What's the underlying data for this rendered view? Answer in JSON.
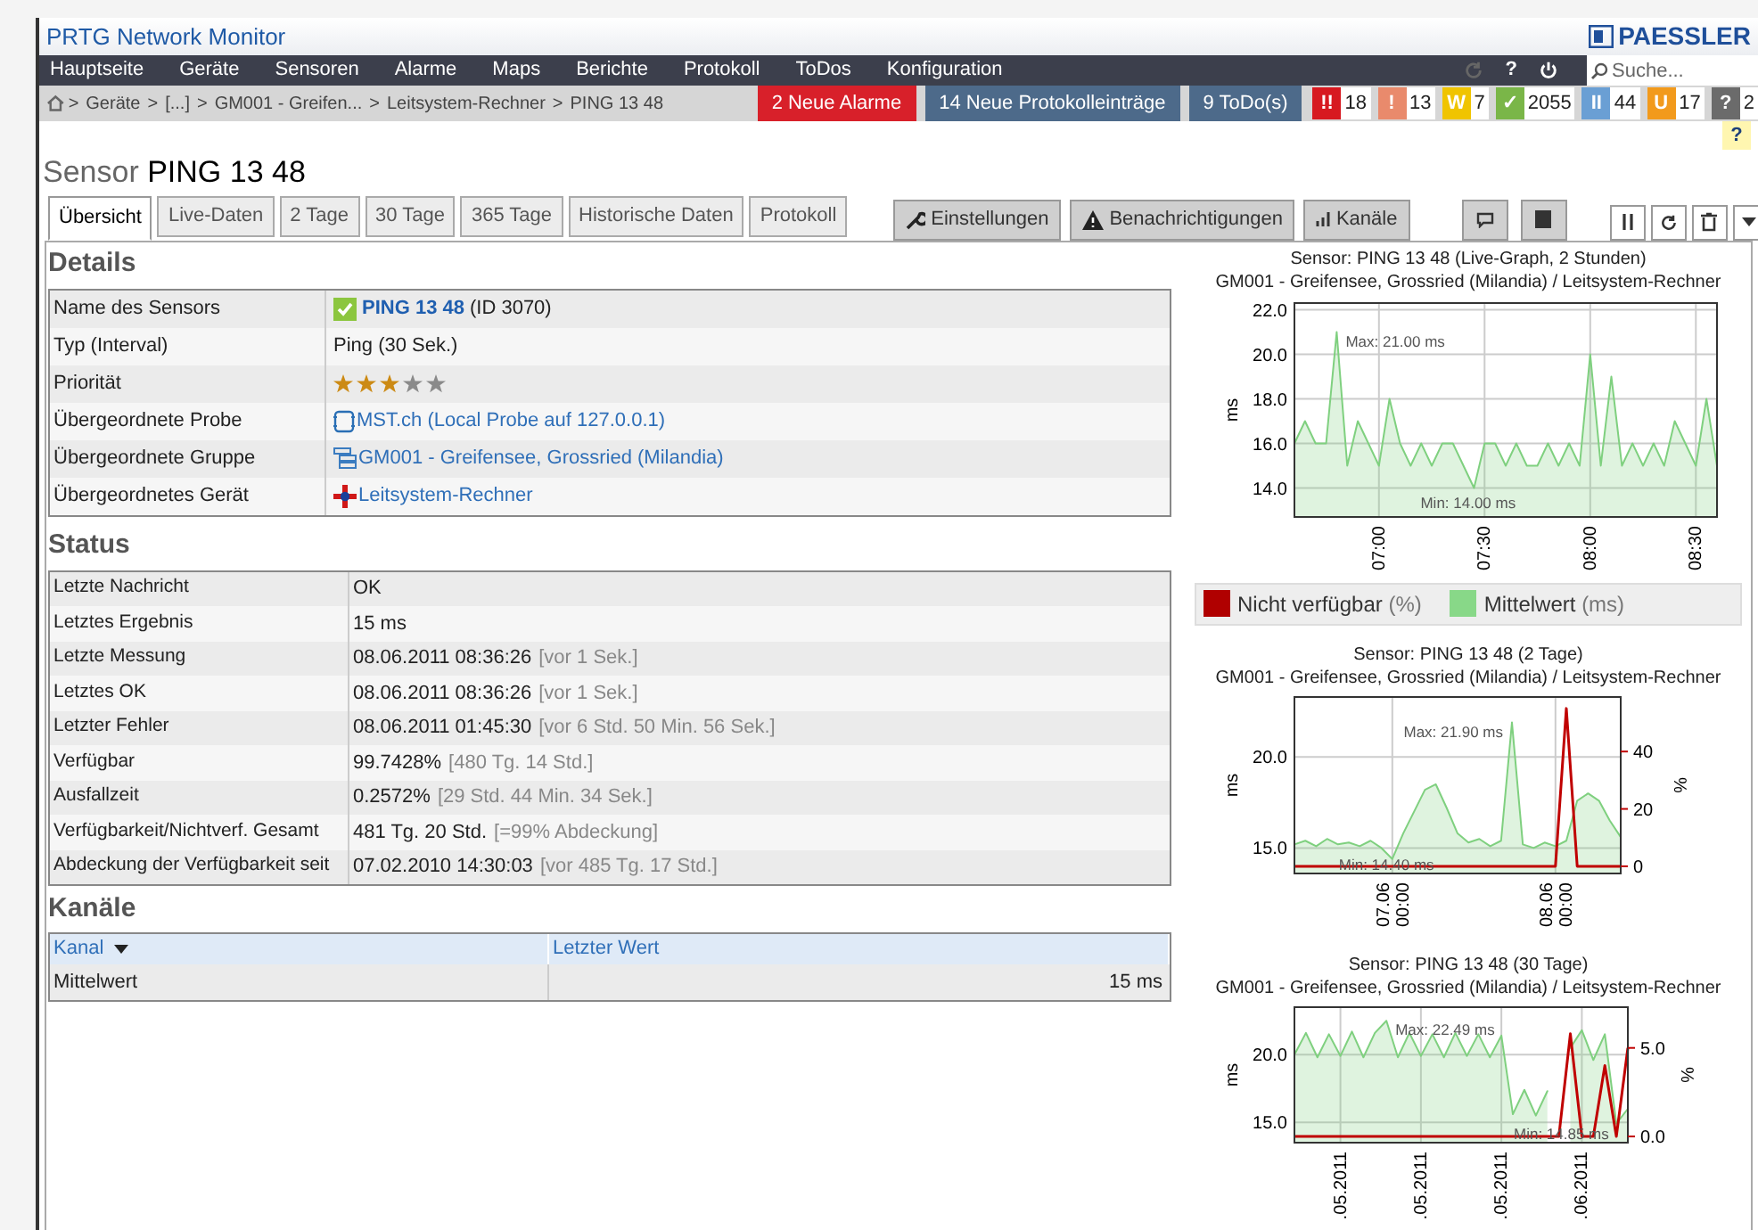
{
  "app": {
    "title": "PRTG Network Monitor",
    "logo": "PAESSLER"
  },
  "menu": [
    "Hauptseite",
    "Geräte",
    "Sensoren",
    "Alarme",
    "Maps",
    "Berichte",
    "Protokoll",
    "ToDos",
    "Konfiguration"
  ],
  "menu_help": "?",
  "search": {
    "placeholder": "Suche..."
  },
  "breadcrumb": {
    "separator": ">",
    "items": [
      "Geräte",
      "[...]",
      "GM001 - Greifen...",
      "Leitsystem-Rechner",
      "PING 13 48"
    ]
  },
  "notices": [
    {
      "label": "2 Neue Alarme",
      "color": "#d8202a"
    },
    {
      "label": "14 Neue Protokolleinträge",
      "color": "#4d6a8a"
    },
    {
      "label": "9 ToDo(s)",
      "color": "#4d6a8a"
    }
  ],
  "counters": [
    {
      "symbol": "!!",
      "count": "18",
      "color": "#d71920"
    },
    {
      "symbol": "!",
      "count": "13",
      "color": "#e98a6c"
    },
    {
      "symbol": "W",
      "count": "7",
      "color": "#f0c400"
    },
    {
      "symbol": "✓",
      "count": "2055",
      "color": "#7ab648"
    },
    {
      "symbol": "II",
      "count": "44",
      "color": "#6a9fd4"
    },
    {
      "symbol": "U",
      "count": "17",
      "color": "#f29a1c"
    },
    {
      "symbol": "?",
      "count": "2",
      "color": "#6b6b6b"
    }
  ],
  "help_badge": "?",
  "page_title": {
    "prefix": "Sensor",
    "name": "PING 13 48"
  },
  "tabs": [
    {
      "label": "Übersicht",
      "selected": true
    },
    {
      "label": "Live-Daten",
      "selected": false
    },
    {
      "label": "2 Tage",
      "selected": false
    },
    {
      "label": "30 Tage",
      "selected": false
    },
    {
      "label": "365 Tage",
      "selected": false
    },
    {
      "label": "Historische Daten",
      "selected": false
    },
    {
      "label": "Protokoll",
      "selected": false
    }
  ],
  "actions": [
    {
      "label": "Einstellungen",
      "kind": "settings"
    },
    {
      "label": "Benachrichtigungen",
      "kind": "notifications"
    },
    {
      "label": "Kanäle",
      "kind": "channels"
    }
  ],
  "details": {
    "heading": "Details",
    "rows": [
      {
        "label": "Name des Sensors",
        "kind": "sensor",
        "value": "PING 13 48",
        "suffix": "(ID 3070)"
      },
      {
        "label": "Typ (Interval)",
        "kind": "text",
        "value": "Ping (30 Sek.)"
      },
      {
        "label": "Priorität",
        "kind": "stars",
        "stars": 3
      },
      {
        "label": "Übergeordnete Probe",
        "kind": "probe",
        "value": "MST.ch (Local Probe auf 127.0.0.1)"
      },
      {
        "label": "Übergeordnete Gruppe",
        "kind": "group",
        "value": "GM001 - Greifensee, Grossried (Milandia)"
      },
      {
        "label": "Übergeordnetes Gerät",
        "kind": "device",
        "value": "Leitsystem-Rechner"
      }
    ]
  },
  "status": {
    "heading": "Status",
    "rows": [
      {
        "label": "Letzte Nachricht",
        "value": "OK"
      },
      {
        "label": "Letztes Ergebnis",
        "value": "15 ms"
      },
      {
        "label": "Letzte Messung",
        "value": "08.06.2011 08:36:26",
        "note": "[vor 1 Sek.]"
      },
      {
        "label": "Letztes OK",
        "value": "08.06.2011 08:36:26",
        "note": "[vor 1 Sek.]"
      },
      {
        "label": "Letzter Fehler",
        "value": "08.06.2011 01:45:30",
        "note": "[vor 6 Std. 50 Min. 56 Sek.]"
      },
      {
        "label": "Verfügbar",
        "value": "99.7428%",
        "note": "[480 Tg. 14 Std.]"
      },
      {
        "label": "Ausfallzeit",
        "value": "0.2572%",
        "note": "[29 Std. 44 Min. 34 Sek.]"
      },
      {
        "label": "Verfügbarkeit/Nichtverf. Gesamt",
        "value": "481 Tg. 20 Std.",
        "note": "[=99% Abdeckung]"
      },
      {
        "label": "Abdeckung der Verfügbarkeit seit",
        "value": "07.02.2010 14:30:03",
        "note": "[vor 485 Tg. 17 Std.]"
      }
    ]
  },
  "channels": {
    "heading": "Kanäle",
    "columns": [
      {
        "label": "Kanal",
        "sorted": true
      },
      {
        "label": "Letzter Wert",
        "sorted": false
      }
    ],
    "rows": [
      [
        "Mittelwert",
        "15 ms"
      ]
    ]
  },
  "charts": [
    {
      "chart_data": {
        "type": "area",
        "title": "Sensor: PING 13 48 (Live-Graph, 2 Stunden)",
        "subtitle": "GM001 - Greifensee, Grossried (Milandia) / Leitsystem-Rechner",
        "ylabel": "ms",
        "ylim": [
          12.7,
          22.3
        ],
        "categories": [
          null,
          null,
          null,
          null,
          null,
          null,
          null,
          null,
          "07:00",
          null,
          null,
          null,
          null,
          null,
          null,
          null,
          null,
          null,
          "07:30",
          null,
          null,
          null,
          null,
          null,
          null,
          null,
          null,
          null,
          "08:00",
          null,
          null,
          null,
          null,
          null,
          null,
          null,
          null,
          null,
          "08:30",
          null,
          null
        ],
        "series": [
          {
            "color": "#7fd07f",
            "values": [
              16,
              17,
              16,
              16,
              21,
              15,
              17,
              16,
              15,
              18,
              16,
              15,
              16,
              15,
              16,
              16,
              15,
              14,
              16,
              16,
              15,
              16,
              15,
              15,
              16,
              15,
              16,
              15,
              20,
              15,
              19,
              15,
              16,
              15,
              16,
              15,
              17,
              16,
              15,
              18,
              15
            ]
          }
        ],
        "yticks": [
          {
            "value": 14,
            "label": "14.0"
          },
          {
            "value": 16,
            "label": "16.0"
          },
          {
            "value": 18,
            "label": "18.0"
          },
          {
            "value": 20,
            "label": "20.0"
          },
          {
            "value": 22,
            "label": "22.0"
          }
        ],
        "grid": true,
        "annotations": [
          "Max: 21.00 ms",
          "Min: 14.00 ms"
        ]
      }
    },
    {
      "legend": [
        {
          "name": "Nicht verfügbar",
          "unit": "(%)",
          "color": "#b00000"
        },
        {
          "name": "Mittelwert",
          "unit": "(ms)",
          "color": "#88d888"
        }
      ]
    },
    {
      "chart_data": {
        "type": "area",
        "title": "Sensor: PING 13 48 (2 Tage)",
        "subtitle": "GM001 - Greifensee, Grossried (Milandia) / Leitsystem-Rechner",
        "ylabel": "ms",
        "y2label": "%",
        "ylim": [
          13.6,
          23.3
        ],
        "y2lim": [
          -2.5,
          59
        ],
        "categories": [
          null,
          null,
          null,
          null,
          null,
          null,
          null,
          null,
          null,
          "07.06 00:00",
          null,
          null,
          null,
          null,
          null,
          null,
          null,
          null,
          null,
          null,
          null,
          null,
          null,
          null,
          "08.06 00:00",
          null,
          null,
          null,
          null,
          null,
          null
        ],
        "series": [
          {
            "color": "#7fd07f",
            "values": [
              15.2,
              15.4,
              15.1,
              15.5,
              15.2,
              15.3,
              15.1,
              15.4,
              15.0,
              14.4,
              15.8,
              17.0,
              18.2,
              18.5,
              17.2,
              15.8,
              15.3,
              15.5,
              15.1,
              15.4,
              21.9,
              15.2,
              15.0,
              15.3,
              15.1,
              15.4,
              17.6,
              18.0,
              17.6,
              16.5,
              15.6
            ]
          },
          {
            "color": "#c00000",
            "axis": "y2",
            "type": "line",
            "values": [
              0,
              0,
              0,
              0,
              0,
              0,
              0,
              0,
              0,
              0,
              0,
              0,
              0,
              0,
              0,
              0,
              0,
              0,
              0,
              0,
              0,
              0,
              0,
              0,
              0,
              55,
              0,
              0,
              0,
              0,
              0
            ]
          }
        ],
        "yticks": [
          {
            "value": 15,
            "label": "15.0"
          },
          {
            "value": 20,
            "label": "20.0"
          }
        ],
        "y2ticks": [
          0,
          20,
          40
        ],
        "grid": true,
        "annotations": [
          "Max: 21.90 ms",
          "Min: 14.40 ms"
        ]
      }
    },
    {
      "chart_data": {
        "type": "area",
        "title": "Sensor: PING 13 48 (30 Tage)",
        "subtitle": "GM001 - Greifensee, Grossried (Milandia) / Leitsystem-Rechner",
        "ylabel": "ms",
        "y2label": "%",
        "ylim": [
          13.5,
          23.5
        ],
        "y2lim": [
          -0.35,
          7.3
        ],
        "categories": [
          null,
          null,
          null,
          null,
          ".05.2011",
          null,
          null,
          null,
          null,
          null,
          null,
          ".05.2011",
          null,
          null,
          null,
          null,
          null,
          null,
          ".05.2011",
          null,
          null,
          null,
          null,
          null,
          null,
          ".06.2011",
          null,
          null,
          null,
          null
        ],
        "series": [
          {
            "color": "#7fd07f",
            "values": [
              20.0,
              21.6,
              19.8,
              21.5,
              19.9,
              21.7,
              19.8,
              21.6,
              22.5,
              19.8,
              21.6,
              19.9,
              21.5,
              19.8,
              21.6,
              19.9,
              21.5,
              19.8,
              21.4,
              15.6,
              17.4,
              15.5,
              17.3,
              null,
              20.5,
              21.8,
              19.6,
              21.5,
              14.9,
              16.0
            ]
          },
          {
            "color": "#c00000",
            "axis": "y2",
            "type": "line",
            "values": [
              0,
              0,
              0,
              0,
              0,
              0,
              0,
              0,
              0,
              0,
              0,
              0,
              0,
              0,
              0,
              0,
              0,
              0,
              0,
              0,
              0,
              0,
              0,
              0,
              5.8,
              0,
              0,
              4.0,
              0,
              5.0
            ]
          }
        ],
        "yticks": [
          {
            "value": 15,
            "label": "15.0"
          },
          {
            "value": 20,
            "label": "20.0"
          }
        ],
        "y2ticks": [
          {
            "value": 0,
            "label": "0.0"
          },
          {
            "value": 5,
            "label": "5.0"
          }
        ],
        "grid": true,
        "annotations": [
          "Max: 22.49 ms",
          "Min: 14.85 ms"
        ]
      }
    }
  ]
}
